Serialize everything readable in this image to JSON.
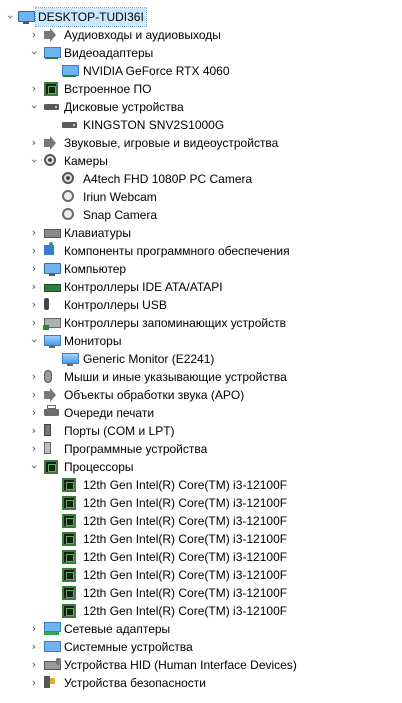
{
  "tree": [
    {
      "label": "DESKTOP-TUDI36I",
      "level": 0,
      "expander": "open",
      "icon": "computer-icon",
      "selected": true
    },
    {
      "label": "Аудиовходы и аудиовыходы",
      "level": 1,
      "expander": "closed",
      "icon": "speaker-icon"
    },
    {
      "label": "Видеоадаптеры",
      "level": 1,
      "expander": "open",
      "icon": "display-adapter-icon"
    },
    {
      "label": "NVIDIA GeForce RTX 4060",
      "level": 2,
      "expander": "none",
      "icon": "display-adapter-icon"
    },
    {
      "label": "Встроенное ПО",
      "level": 1,
      "expander": "closed",
      "icon": "chip-icon"
    },
    {
      "label": "Дисковые устройства",
      "level": 1,
      "expander": "open",
      "icon": "disk-drive-icon"
    },
    {
      "label": "KINGSTON SNV2S1000G",
      "level": 2,
      "expander": "none",
      "icon": "disk-drive-icon"
    },
    {
      "label": "Звуковые, игровые и видеоустройства",
      "level": 1,
      "expander": "closed",
      "icon": "speaker-icon"
    },
    {
      "label": "Камеры",
      "level": 1,
      "expander": "open",
      "icon": "camera-icon"
    },
    {
      "label": "A4tech FHD 1080P PC Camera",
      "level": 2,
      "expander": "none",
      "icon": "camera-icon"
    },
    {
      "label": "Iriun Webcam",
      "level": 2,
      "expander": "none",
      "icon": "camera-alt-icon"
    },
    {
      "label": "Snap Camera",
      "level": 2,
      "expander": "none",
      "icon": "camera-alt-icon"
    },
    {
      "label": "Клавиатуры",
      "level": 1,
      "expander": "closed",
      "icon": "keyboard-icon"
    },
    {
      "label": "Компоненты программного обеспечения",
      "level": 1,
      "expander": "closed",
      "icon": "puzzle-icon"
    },
    {
      "label": "Компьютер",
      "level": 1,
      "expander": "closed",
      "icon": "computer-icon"
    },
    {
      "label": "Контроллеры IDE ATA/ATAPI",
      "level": 1,
      "expander": "closed",
      "icon": "ide-controller-icon"
    },
    {
      "label": "Контроллеры USB",
      "level": 1,
      "expander": "closed",
      "icon": "usb-icon"
    },
    {
      "label": "Контроллеры запоминающих устройств",
      "level": 1,
      "expander": "closed",
      "icon": "storage-controller-icon"
    },
    {
      "label": "Мониторы",
      "level": 1,
      "expander": "open",
      "icon": "monitor-icon"
    },
    {
      "label": "Generic Monitor (E2241)",
      "level": 2,
      "expander": "none",
      "icon": "monitor-icon"
    },
    {
      "label": "Мыши и иные указывающие устройства",
      "level": 1,
      "expander": "closed",
      "icon": "mouse-icon"
    },
    {
      "label": "Объекты обработки звука (APO)",
      "level": 1,
      "expander": "closed",
      "icon": "speaker-icon"
    },
    {
      "label": "Очереди печати",
      "level": 1,
      "expander": "closed",
      "icon": "printer-icon"
    },
    {
      "label": "Порты (COM и LPT)",
      "level": 1,
      "expander": "closed",
      "icon": "port-icon"
    },
    {
      "label": "Программные устройства",
      "level": 1,
      "expander": "closed",
      "icon": "software-device-icon"
    },
    {
      "label": "Процессоры",
      "level": 1,
      "expander": "open",
      "icon": "chip-icon"
    },
    {
      "label": "12th Gen Intel(R) Core(TM) i3-12100F",
      "level": 2,
      "expander": "none",
      "icon": "chip-icon"
    },
    {
      "label": "12th Gen Intel(R) Core(TM) i3-12100F",
      "level": 2,
      "expander": "none",
      "icon": "chip-icon"
    },
    {
      "label": "12th Gen Intel(R) Core(TM) i3-12100F",
      "level": 2,
      "expander": "none",
      "icon": "chip-icon"
    },
    {
      "label": "12th Gen Intel(R) Core(TM) i3-12100F",
      "level": 2,
      "expander": "none",
      "icon": "chip-icon"
    },
    {
      "label": "12th Gen Intel(R) Core(TM) i3-12100F",
      "level": 2,
      "expander": "none",
      "icon": "chip-icon"
    },
    {
      "label": "12th Gen Intel(R) Core(TM) i3-12100F",
      "level": 2,
      "expander": "none",
      "icon": "chip-icon"
    },
    {
      "label": "12th Gen Intel(R) Core(TM) i3-12100F",
      "level": 2,
      "expander": "none",
      "icon": "chip-icon"
    },
    {
      "label": "12th Gen Intel(R) Core(TM) i3-12100F",
      "level": 2,
      "expander": "none",
      "icon": "chip-icon"
    },
    {
      "label": "Сетевые адаптеры",
      "level": 1,
      "expander": "closed",
      "icon": "network-adapter-icon"
    },
    {
      "label": "Системные устройства",
      "level": 1,
      "expander": "closed",
      "icon": "system-device-icon"
    },
    {
      "label": "Устройства HID (Human Interface Devices)",
      "level": 1,
      "expander": "closed",
      "icon": "hid-icon"
    },
    {
      "label": "Устройства безопасности",
      "level": 1,
      "expander": "closed",
      "icon": "security-device-icon"
    }
  ],
  "colors": {
    "selection": "#cce8ff",
    "text": "#000000",
    "background": "#ffffff"
  }
}
